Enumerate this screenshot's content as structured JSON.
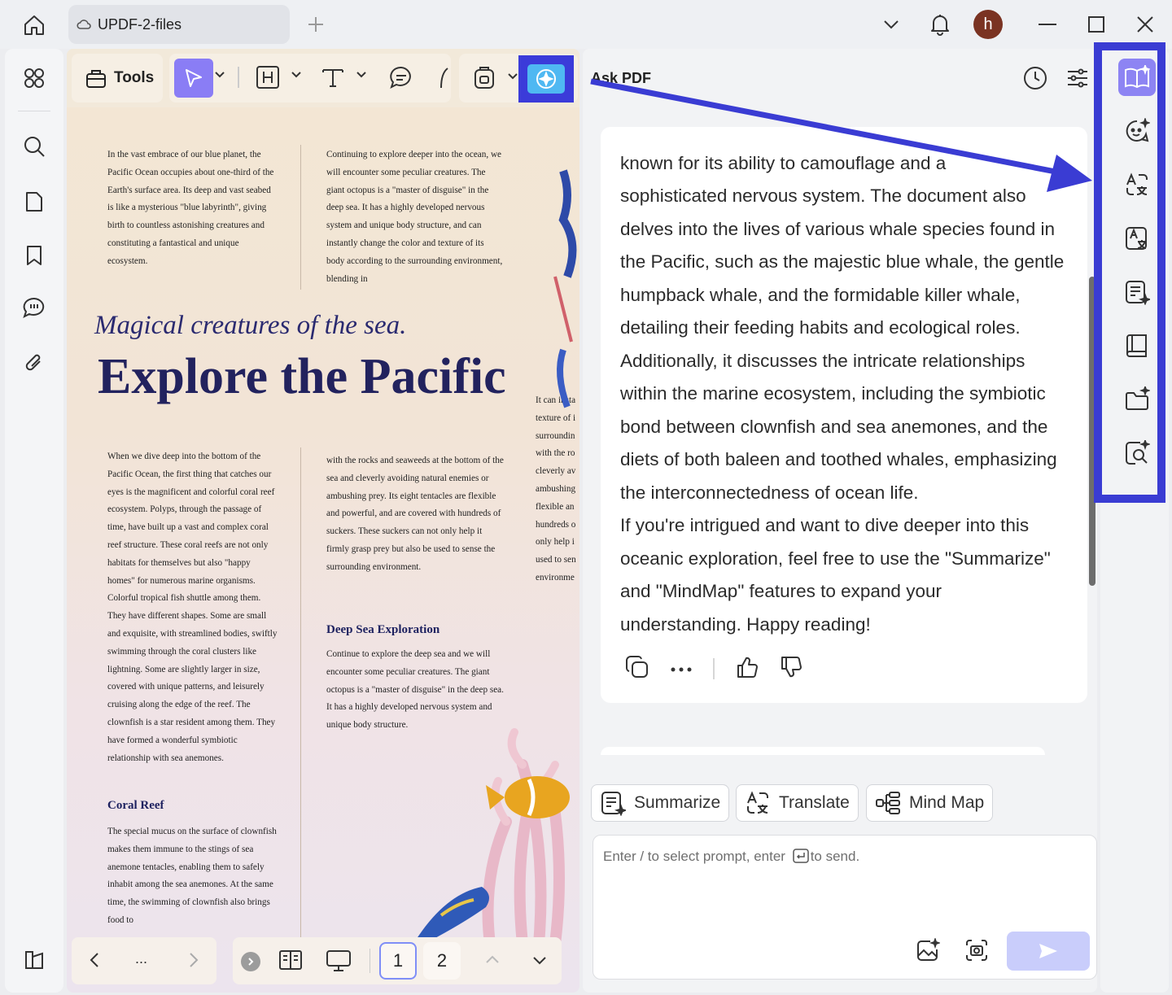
{
  "titlebar": {
    "tab_label": "UPDF-2-files",
    "avatar_letter": "h"
  },
  "toolbar": {
    "tools_label": "Tools"
  },
  "document": {
    "col1_top": "In the vast embrace of our blue planet, the Pacific Ocean occupies about one-third of the Earth's surface area. Its deep and vast seabed is like a mysterious \"blue labyrinth\", giving birth to countless astonishing creatures and constituting a fantastical and unique ecosystem.",
    "col2_top": "Continuing to explore deeper into the ocean, we will encounter some peculiar creatures. The giant octopus is a \"master of disguise\" in the deep sea. It has a highly developed nervous system and unique body structure, and can instantly change the color and texture of its body according to the surrounding environment, blending in",
    "subtitle": "Magical creatures of the sea.",
    "title": "Explore the Pacific",
    "col3_partial": "It can insta texture of i surroundin with the ro cleverly av ambushing flexible an hundreds o only help i used to sen environme",
    "col1_mid": "When we dive deep into the bottom of the Pacific Ocean, the first thing that catches our eyes is the magnificent and colorful coral reef ecosystem. Polyps, through the passage of time, have built up a vast and complex coral reef structure. These coral reefs are not only habitats for themselves but also \"happy homes\" for numerous marine organisms. Colorful tropical fish shuttle among them. They have different shapes. Some are small and exquisite, with streamlined bodies, swiftly swimming through the coral clusters like lightning. Some are slightly larger in size, covered with unique patterns, and leisurely cruising along the edge of the reef. The clownfish is a star resident among them. They have formed a wonderful symbiotic relationship with sea anemones.",
    "col2_mid": "with the rocks and seaweeds at the bottom of the sea and cleverly avoiding natural enemies or ambushing prey. Its eight tentacles are flexible and powerful, and are covered with hundreds of suckers. These suckers can not only help it firmly grasp prey but also be used to sense the surrounding environment.",
    "heading_deep": "Deep Sea Exploration",
    "col2_deep": "Continue to explore the deep sea and we will encounter some peculiar creatures. The giant octopus is a \"master of disguise\" in the deep sea. It has a highly developed nervous system and unique body structure.",
    "heading_coral": "Coral Reef",
    "col1_coral": "The special mucus on the surface of clownfish makes them immune to the stings of sea anemone tentacles, enabling them to safely inhabit among the sea anemones. At the same time, the swimming of clownfish also brings food to"
  },
  "pager": {
    "more": "...",
    "page1": "1",
    "page2": "2"
  },
  "ask_pdf": {
    "title": "Ask PDF",
    "answer_lines": [
      "known for its ability to camouflage and a",
      "sophisticated nervous system. The document also",
      "delves into the lives of various whale species found in",
      "the Pacific, such as the majestic blue whale, the gentle",
      "humpback whale, and the formidable killer whale,",
      "detailing their feeding habits and ecological roles.",
      "Additionally, it discusses the intricate relationships",
      "within the marine ecosystem, including the symbiotic",
      "bond between clownfish and sea anemones, and the",
      "diets of both baleen and toothed whales, emphasizing",
      "the interconnectedness of ocean life.",
      "If you're intrigued and want to dive deeper into this",
      "oceanic exploration, feel free to use the \"Summarize\"",
      "and \"MindMap\" features to expand your",
      "understanding. Happy reading!"
    ],
    "chips": {
      "summarize": "Summarize",
      "translate": "Translate",
      "mindmap": "Mind Map"
    },
    "input_placeholder_a": "Enter / to select prompt, enter",
    "input_placeholder_b": "to send."
  },
  "colors": {
    "accent": "#3a3cd3",
    "select_active": "#8a7df5",
    "send_disabled": "#c9cdfb"
  }
}
